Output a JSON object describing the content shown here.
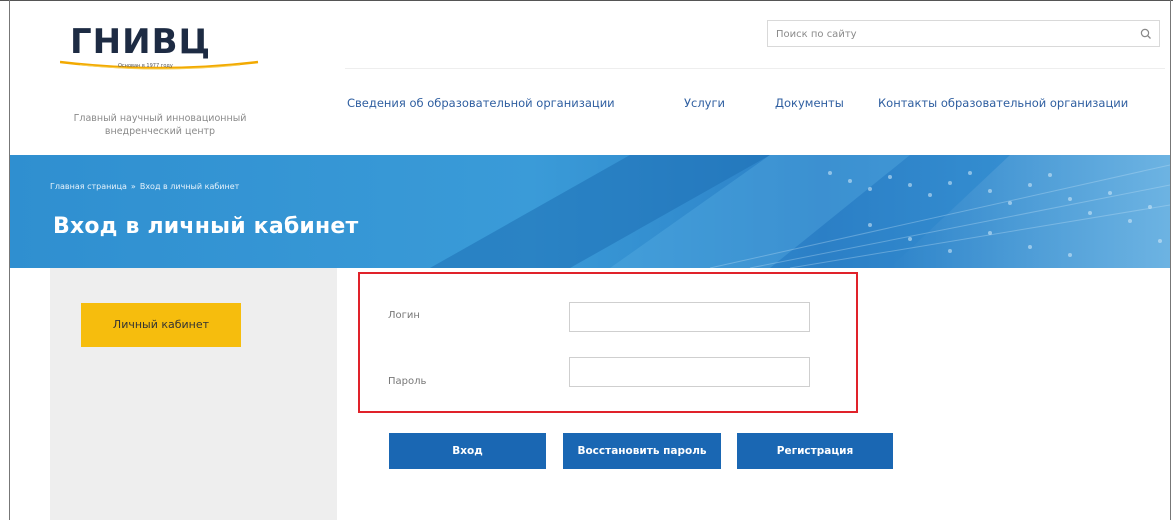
{
  "logo": {
    "name": "ГНИВЦ",
    "small_text": "Основан в 1977 году",
    "subtitle_line1": "Главный научный инновационный",
    "subtitle_line2": "внедренческий центр"
  },
  "search": {
    "placeholder": "Поиск по сайту",
    "icon": "search-icon"
  },
  "nav": {
    "items": [
      {
        "label": "Сведения об образовательной организации"
      },
      {
        "label": "Услуги"
      },
      {
        "label": "Документы"
      },
      {
        "label": "Контакты образовательной организации"
      }
    ]
  },
  "breadcrumb": {
    "home": "Главная страница",
    "separator": "»",
    "current": "Вход в личный кабинет"
  },
  "page_title": "Вход в личный кабинет",
  "sidebar": {
    "button_label": "Личный кабинет"
  },
  "form": {
    "login_label": "Логин",
    "password_label": "Пароль",
    "login_value": "",
    "password_value": ""
  },
  "buttons": {
    "login": "Вход",
    "restore": "Восстановить пароль",
    "register": "Регистрация"
  },
  "colors": {
    "brand_blue": "#1a67b3",
    "accent_yellow": "#f6bd0d",
    "nav_link": "#2e5ea0",
    "highlight_red": "#e0222a",
    "hero_blue": "#3a9bd8"
  }
}
